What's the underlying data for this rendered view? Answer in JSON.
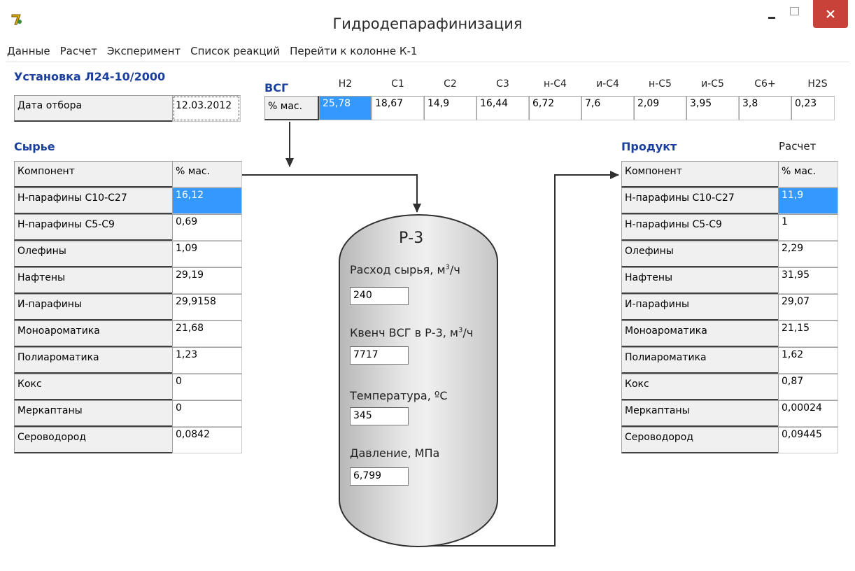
{
  "window": {
    "title": "Гидродепарафинизация"
  },
  "menu": [
    "Данные",
    "Расчет",
    "Эксперимент",
    "Список реакций",
    "Перейти к колонне К-1"
  ],
  "unit": {
    "title": "Установка Л24-10/2000",
    "date_label": "Дата отбора",
    "date_value": "12.03.2012"
  },
  "vsg": {
    "title": "ВСГ",
    "row_label": "% мас.",
    "headers": [
      "H2",
      "C1",
      "C2",
      "C3",
      "н-C4",
      "и-C4",
      "н-C5",
      "и-C5",
      "C6+",
      "H2S"
    ],
    "values": [
      "25,78",
      "18,67",
      "14,9",
      "16,44",
      "6,72",
      "7,6",
      "2,09",
      "3,95",
      "3,8",
      "0,23"
    ]
  },
  "feed": {
    "title": "Сырье",
    "col_component": "Компонент",
    "col_mass": "% мас.",
    "rows": [
      {
        "name": "Н-парафины С10-С27",
        "value": "16,12"
      },
      {
        "name": "Н-парафины С5-С9",
        "value": "0,69"
      },
      {
        "name": "Олефины",
        "value": "1,09"
      },
      {
        "name": "Нафтены",
        "value": "29,19"
      },
      {
        "name": "И-парафины",
        "value": "29,9158"
      },
      {
        "name": "Моноароматика",
        "value": "21,68"
      },
      {
        "name": "Полиароматика",
        "value": "1,23"
      },
      {
        "name": "Кокс",
        "value": "0"
      },
      {
        "name": "Меркаптаны",
        "value": "0"
      },
      {
        "name": "Сероводород",
        "value": "0,0842"
      }
    ]
  },
  "product": {
    "title": "Продукт",
    "calc_label": "Расчет",
    "col_component": "Компонент",
    "col_mass": "% мас.",
    "rows": [
      {
        "name": "Н-парафины С10-С27",
        "value": "11,9"
      },
      {
        "name": "Н-парафины С5-С9",
        "value": "1"
      },
      {
        "name": "Олефины",
        "value": "2,29"
      },
      {
        "name": "Нафтены",
        "value": "31,95"
      },
      {
        "name": "И-парафины",
        "value": "29,07"
      },
      {
        "name": "Моноароматика",
        "value": "21,15"
      },
      {
        "name": "Полиароматика",
        "value": "1,62"
      },
      {
        "name": "Кокс",
        "value": "0,87"
      },
      {
        "name": "Меркаптаны",
        "value": "0,00024"
      },
      {
        "name": "Сероводород",
        "value": "0,09445"
      }
    ]
  },
  "reactor": {
    "title": "Р-3",
    "feed_flow_label": "Расход сырья, м",
    "feed_flow_unit_sup": "3",
    "feed_flow_unit_tail": "/ч",
    "feed_flow_value": "240",
    "quench_label": "Квенч ВСГ в Р-3, м",
    "quench_unit_sup": "3",
    "quench_unit_tail": "/ч",
    "quench_value": "7717",
    "temp_label": "Температура, ºС",
    "temp_value": "345",
    "pressure_label": "Давление, МПа",
    "pressure_value": "6,799"
  },
  "colors": {
    "selection": "#3399ff",
    "section_title": "#1a3f9c",
    "close_button": "#c8423a"
  }
}
